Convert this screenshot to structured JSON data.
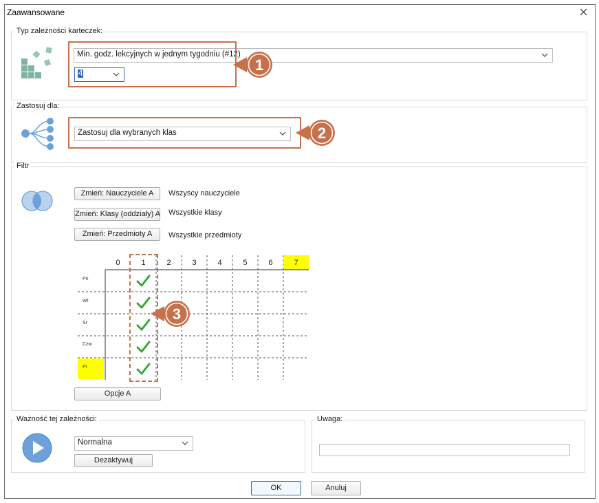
{
  "window": {
    "title": "Zaawansowane"
  },
  "type_group": {
    "label": "Typ zależności karteczek:",
    "type_value": "Min. godz. lekcyjnych w jednym tygodniu (#12)",
    "number_value": "4"
  },
  "apply_group": {
    "label": "Zastosuj dla:",
    "apply_value": "Zastosuj dla wybranych klas"
  },
  "filter_group": {
    "label": "Filtr",
    "rows": [
      {
        "button": "Zmień: Nauczyciele A",
        "text": "Wszyscy nauczyciele"
      },
      {
        "button": "Zmień: Klasy (oddziały) A",
        "text": "Wszystkie klasy"
      },
      {
        "button": "Zmień: Przedmioty A",
        "text": "Wszystkie przedmioty"
      }
    ],
    "grid": {
      "columns": [
        "0",
        "1",
        "2",
        "3",
        "4",
        "5",
        "6",
        "7"
      ],
      "highlighted_column": "7",
      "days": [
        "Pn",
        "Wt",
        "Śr",
        "Czw",
        "Pi"
      ],
      "highlighted_day": "Pi",
      "checked_column": "1",
      "highlight_color": "#ffff00",
      "check_color": "#3aa635"
    },
    "options_button": "Opcje A"
  },
  "importance_group": {
    "label": "Ważność tej zależności:",
    "value": "Normalna",
    "deactivate_button": "Dezaktywuj"
  },
  "note_group": {
    "label": "Uwaga:",
    "value": ""
  },
  "footer": {
    "ok": "OK",
    "cancel": "Anuluj"
  },
  "callouts": {
    "color": "#c8704a",
    "numbers": [
      "1",
      "2",
      "3"
    ]
  }
}
